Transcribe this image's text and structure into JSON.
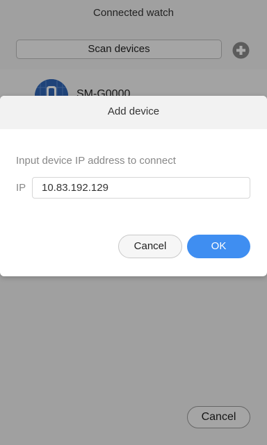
{
  "screen": {
    "title": "Connected watch",
    "scan_button_label": "Scan devices",
    "add_icon": "plus-circle-icon",
    "device": {
      "name": "SM-G0000",
      "icon": "watch-icon"
    },
    "cancel_label": "Cancel"
  },
  "dialog": {
    "title": "Add device",
    "message": "Input device IP address to connect",
    "ip_label": "IP",
    "ip_value": "10.83.192.129",
    "cancel_label": "Cancel",
    "ok_label": "OK",
    "ok_color": "#3f8ef1"
  }
}
